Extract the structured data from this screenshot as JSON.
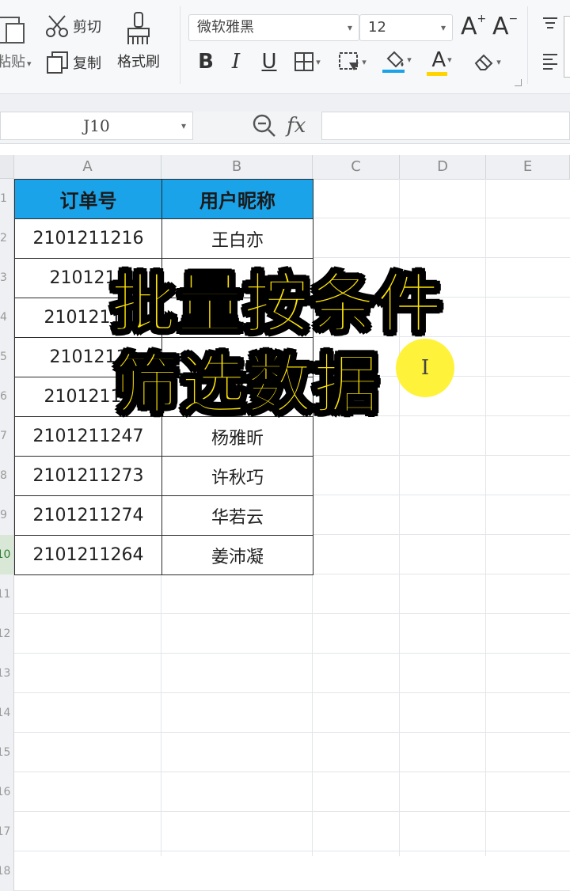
{
  "ribbon": {
    "paste_label": "粘贴",
    "cut_label": "剪切",
    "copy_label": "复制",
    "format_painter_label": "格式刷",
    "font_name": "微软雅黑",
    "font_size": "12",
    "grow_font": "A",
    "shrink_font": "A",
    "bold": "B",
    "italic": "I",
    "underline": "U",
    "font_color_glyph": "A"
  },
  "formula_bar": {
    "cell_ref": "J10",
    "fx_label": "fx",
    "value": ""
  },
  "columns": [
    "A",
    "B",
    "C",
    "D",
    "E"
  ],
  "rows": [
    "1",
    "2",
    "3",
    "4",
    "5",
    "6",
    "7",
    "8",
    "9",
    "10",
    "11",
    "12",
    "13",
    "14",
    "15",
    "16",
    "17",
    "18"
  ],
  "table": {
    "headers": [
      "订单号",
      "用户昵称"
    ],
    "rows": [
      [
        "2101211216",
        "王白亦"
      ],
      [
        "2101211",
        ""
      ],
      [
        "21012112",
        ""
      ],
      [
        "2101211",
        ""
      ],
      [
        "21012112",
        ""
      ],
      [
        "2101211247",
        "杨雅昕"
      ],
      [
        "2101211273",
        "许秋巧"
      ],
      [
        "2101211274",
        "华若云"
      ],
      [
        "2101211264",
        "姜沛凝"
      ]
    ]
  },
  "overlay": {
    "line1": "批量按条件",
    "line2": "筛选数据"
  },
  "cursor_glyph": "I"
}
